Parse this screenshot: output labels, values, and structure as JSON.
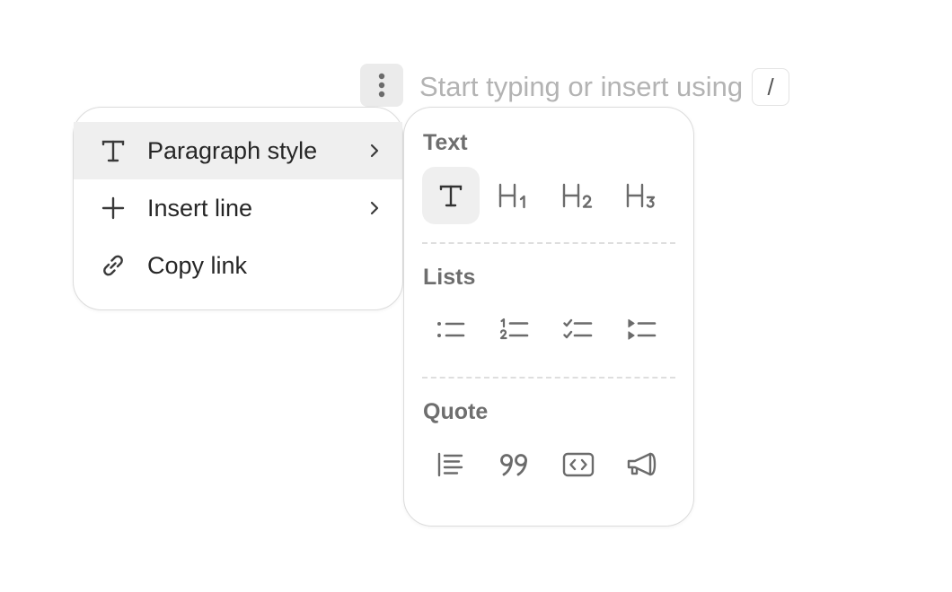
{
  "editor": {
    "placeholder": "Start typing or insert using",
    "shortcut_key": "/",
    "handle_icon": "vertical-dots-icon"
  },
  "menu": {
    "items": [
      {
        "label": "Paragraph style",
        "icon": "text-style-icon",
        "has_submenu": true,
        "active": true
      },
      {
        "label": "Insert line",
        "icon": "plus-icon",
        "has_submenu": true,
        "active": false
      },
      {
        "label": "Copy link",
        "icon": "link-icon",
        "has_submenu": false,
        "active": false
      }
    ]
  },
  "submenu": {
    "sections": [
      {
        "title": "Text",
        "icons": [
          "paragraph-icon",
          "heading-1-icon",
          "heading-2-icon",
          "heading-3-icon"
        ],
        "selected": "paragraph-icon"
      },
      {
        "title": "Lists",
        "icons": [
          "bullet-list-icon",
          "numbered-list-icon",
          "checklist-icon",
          "toggle-list-icon"
        ]
      },
      {
        "title": "Quote",
        "icons": [
          "blockquote-icon",
          "quote-icon",
          "code-block-icon",
          "callout-icon"
        ]
      }
    ]
  },
  "colors": {
    "active_bg": "#efefef",
    "placeholder_text": "#b3b3b3",
    "section_title": "#6e6e6e",
    "icon_gray": "#6b6b6b"
  }
}
